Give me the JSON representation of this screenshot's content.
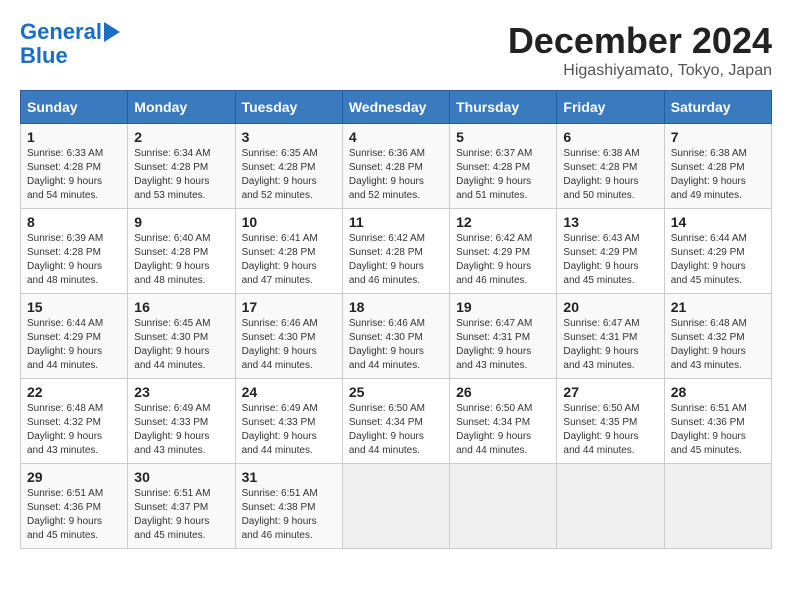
{
  "header": {
    "logo_line1": "General",
    "logo_line2": "Blue",
    "title": "December 2024",
    "subtitle": "Higashiyamato, Tokyo, Japan"
  },
  "weekdays": [
    "Sunday",
    "Monday",
    "Tuesday",
    "Wednesday",
    "Thursday",
    "Friday",
    "Saturday"
  ],
  "weeks": [
    [
      {
        "day": "1",
        "sunrise": "6:33 AM",
        "sunset": "4:28 PM",
        "daylight": "9 hours and 54 minutes."
      },
      {
        "day": "2",
        "sunrise": "6:34 AM",
        "sunset": "4:28 PM",
        "daylight": "9 hours and 53 minutes."
      },
      {
        "day": "3",
        "sunrise": "6:35 AM",
        "sunset": "4:28 PM",
        "daylight": "9 hours and 52 minutes."
      },
      {
        "day": "4",
        "sunrise": "6:36 AM",
        "sunset": "4:28 PM",
        "daylight": "9 hours and 52 minutes."
      },
      {
        "day": "5",
        "sunrise": "6:37 AM",
        "sunset": "4:28 PM",
        "daylight": "9 hours and 51 minutes."
      },
      {
        "day": "6",
        "sunrise": "6:38 AM",
        "sunset": "4:28 PM",
        "daylight": "9 hours and 50 minutes."
      },
      {
        "day": "7",
        "sunrise": "6:38 AM",
        "sunset": "4:28 PM",
        "daylight": "9 hours and 49 minutes."
      }
    ],
    [
      {
        "day": "8",
        "sunrise": "6:39 AM",
        "sunset": "4:28 PM",
        "daylight": "9 hours and 48 minutes."
      },
      {
        "day": "9",
        "sunrise": "6:40 AM",
        "sunset": "4:28 PM",
        "daylight": "9 hours and 48 minutes."
      },
      {
        "day": "10",
        "sunrise": "6:41 AM",
        "sunset": "4:28 PM",
        "daylight": "9 hours and 47 minutes."
      },
      {
        "day": "11",
        "sunrise": "6:42 AM",
        "sunset": "4:28 PM",
        "daylight": "9 hours and 46 minutes."
      },
      {
        "day": "12",
        "sunrise": "6:42 AM",
        "sunset": "4:29 PM",
        "daylight": "9 hours and 46 minutes."
      },
      {
        "day": "13",
        "sunrise": "6:43 AM",
        "sunset": "4:29 PM",
        "daylight": "9 hours and 45 minutes."
      },
      {
        "day": "14",
        "sunrise": "6:44 AM",
        "sunset": "4:29 PM",
        "daylight": "9 hours and 45 minutes."
      }
    ],
    [
      {
        "day": "15",
        "sunrise": "6:44 AM",
        "sunset": "4:29 PM",
        "daylight": "9 hours and 44 minutes."
      },
      {
        "day": "16",
        "sunrise": "6:45 AM",
        "sunset": "4:30 PM",
        "daylight": "9 hours and 44 minutes."
      },
      {
        "day": "17",
        "sunrise": "6:46 AM",
        "sunset": "4:30 PM",
        "daylight": "9 hours and 44 minutes."
      },
      {
        "day": "18",
        "sunrise": "6:46 AM",
        "sunset": "4:30 PM",
        "daylight": "9 hours and 44 minutes."
      },
      {
        "day": "19",
        "sunrise": "6:47 AM",
        "sunset": "4:31 PM",
        "daylight": "9 hours and 43 minutes."
      },
      {
        "day": "20",
        "sunrise": "6:47 AM",
        "sunset": "4:31 PM",
        "daylight": "9 hours and 43 minutes."
      },
      {
        "day": "21",
        "sunrise": "6:48 AM",
        "sunset": "4:32 PM",
        "daylight": "9 hours and 43 minutes."
      }
    ],
    [
      {
        "day": "22",
        "sunrise": "6:48 AM",
        "sunset": "4:32 PM",
        "daylight": "9 hours and 43 minutes."
      },
      {
        "day": "23",
        "sunrise": "6:49 AM",
        "sunset": "4:33 PM",
        "daylight": "9 hours and 43 minutes."
      },
      {
        "day": "24",
        "sunrise": "6:49 AM",
        "sunset": "4:33 PM",
        "daylight": "9 hours and 44 minutes."
      },
      {
        "day": "25",
        "sunrise": "6:50 AM",
        "sunset": "4:34 PM",
        "daylight": "9 hours and 44 minutes."
      },
      {
        "day": "26",
        "sunrise": "6:50 AM",
        "sunset": "4:34 PM",
        "daylight": "9 hours and 44 minutes."
      },
      {
        "day": "27",
        "sunrise": "6:50 AM",
        "sunset": "4:35 PM",
        "daylight": "9 hours and 44 minutes."
      },
      {
        "day": "28",
        "sunrise": "6:51 AM",
        "sunset": "4:36 PM",
        "daylight": "9 hours and 45 minutes."
      }
    ],
    [
      {
        "day": "29",
        "sunrise": "6:51 AM",
        "sunset": "4:36 PM",
        "daylight": "9 hours and 45 minutes."
      },
      {
        "day": "30",
        "sunrise": "6:51 AM",
        "sunset": "4:37 PM",
        "daylight": "9 hours and 45 minutes."
      },
      {
        "day": "31",
        "sunrise": "6:51 AM",
        "sunset": "4:38 PM",
        "daylight": "9 hours and 46 minutes."
      },
      null,
      null,
      null,
      null
    ]
  ],
  "labels": {
    "sunrise": "Sunrise:",
    "sunset": "Sunset:",
    "daylight": "Daylight:"
  }
}
